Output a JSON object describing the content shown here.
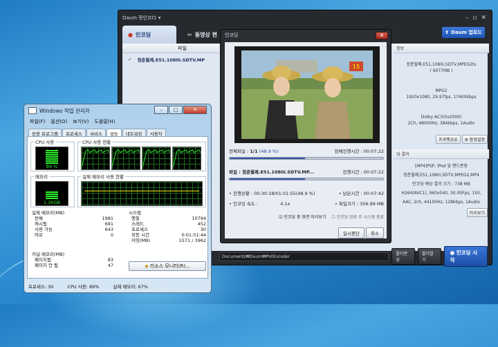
{
  "daum": {
    "title": "Daum 팟인코더",
    "tab_encoding": "인코딩",
    "tab_video": "동영상 편",
    "upload": "Daum 업로드",
    "col_file": "파일",
    "file_name": "정춘월쾌.E51.1080i.SDTV.MP",
    "info_header": "정보",
    "info_file": "정춘월쾌,E51,1080i,SDTV,MPEG2ts",
    "info_size": "( 6077MB )",
    "info_video1": "MPG2",
    "info_video2": "1920x1080, 29.97fps, 17400kbps",
    "info_audio1": "Dolby AC3(0x2000)",
    "info_audio2": "2Ch, 48000Hz, 384kbps, 1Audio",
    "btn_share": "프라벳공유",
    "btn_env": "환경설정",
    "result_header": "딩 결과",
    "result_lines": [
      "[MP4]PSP, iPod 및 핸드폰용",
      "정춘월쾌,E51,1080i,SDTV,MPEG2,MP4",
      "인코딩 예상 결과 크기 : 738 MB",
      "H264(AVC1), 960x540, 30.00Fps, 150,",
      "AAC, 2ch, 44100Hz, 128kbps, 1Audio"
    ],
    "btn_preview": "미리보기",
    "path": "Documents₩Daum₩PotEncoder",
    "btn_change": "폴더변경",
    "btn_open": "폴더열기",
    "btn_start": "인코딩 시작"
  },
  "enc": {
    "title": "인코딩",
    "overlay_num": "15",
    "total_file_label": "전체파일 :",
    "total_file_val": "1/1",
    "total_pct": "(48.9 %)",
    "total_time_label": "전체진행시간 :",
    "total_time": "00:07:22",
    "total_progress": 0.489,
    "file_label": "파일 : 정춘월쾌.E51.1080i.SDTV.MP...",
    "elapsed_label": "진행시간 :",
    "elapsed": "00:07:22",
    "file_progress": 0.489,
    "status_label": "• 진행상황 :",
    "status_val": "00:30:18/01:01:55(48.9 %)",
    "remain_label": "• 남은시간 :",
    "remain_val": "00:07:42",
    "speed_label": "• 인코딩 속도 :",
    "speed_val": "4.1x",
    "size_label": "• 파일크기 :",
    "size_val": "356.99 MB",
    "chk_preview": "인코딩 중 화면 미리보기",
    "chk_shutdown": "인코딩 완료 후 시스템 종료",
    "btn_pause": "일시중단",
    "btn_cancel": "취소"
  },
  "tm": {
    "title": "Windows 작업 관리자",
    "menu": [
      "파일(F)",
      "옵션(O)",
      "보기(V)",
      "도움말(H)"
    ],
    "tabs": [
      "응용 프로그램",
      "프로세스",
      "서비스",
      "성능",
      "네트워킹",
      "사용자"
    ],
    "cpu_usage": "CPU 사용",
    "cpu_pct": "89 %",
    "cpu_history": "CPU 사용 현황",
    "mem": "메모리",
    "mem_val": "1.30GB",
    "mem_history": "실제 메모리 사용 현황",
    "phys_head": "실제 메모리(MB)",
    "phys_rows": [
      [
        "전체",
        "1981"
      ],
      [
        "캐시됨",
        "691"
      ],
      [
        "사용 가능",
        "643"
      ],
      [
        "여유",
        "0"
      ]
    ],
    "sys_head": "시스템",
    "sys_rows": [
      [
        "핸들",
        "10794"
      ],
      [
        "스레드",
        "452"
      ],
      [
        "프로세스",
        "30"
      ],
      [
        "작동 시간",
        "0:01:51:44"
      ],
      [
        "커밋(MB)",
        "1571 / 3962"
      ]
    ],
    "kern_head": "커널 메모리(MB)",
    "kern_rows": [
      [
        "페이지됨",
        "83"
      ],
      [
        "페이지 안 됨",
        "47"
      ]
    ],
    "res_btn": "리소스 모니터(R)...",
    "status_proc": "프로세스: 30",
    "status_cpu": "CPU 사용: 89%",
    "status_mem": "실제 메모리: 67%"
  }
}
